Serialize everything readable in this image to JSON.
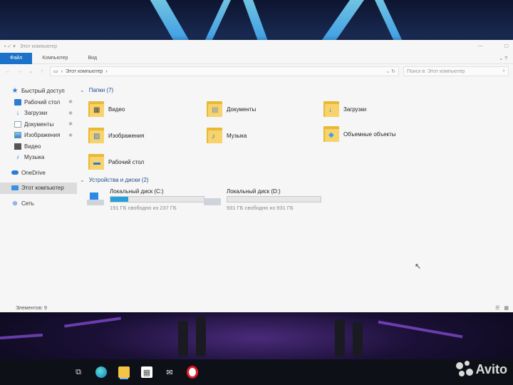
{
  "window": {
    "title_tabs": [
      "Файл",
      "Компьютер",
      "Вид"
    ],
    "address_path": "Этот компьютер",
    "search_placeholder": "Поиск в: Этот компьютер"
  },
  "nav": {
    "items": [
      {
        "label": "Быстрый доступ",
        "icon": "star-icon",
        "pinned": false
      },
      {
        "label": "Рабочий стол",
        "icon": "desktop-icon",
        "pinned": true
      },
      {
        "label": "Загрузки",
        "icon": "download-icon",
        "pinned": true
      },
      {
        "label": "Документы",
        "icon": "document-icon",
        "pinned": true
      },
      {
        "label": "Изображения",
        "icon": "image-icon",
        "pinned": true
      },
      {
        "label": "Видео",
        "icon": "video-icon",
        "pinned": false
      },
      {
        "label": "Музыка",
        "icon": "music-icon",
        "pinned": false
      },
      {
        "label": "OneDrive",
        "icon": "cloud-icon",
        "pinned": false
      },
      {
        "label": "Этот компьютер",
        "icon": "computer-icon",
        "pinned": false
      },
      {
        "label": "Сеть",
        "icon": "network-icon",
        "pinned": false
      }
    ]
  },
  "folders": {
    "header": "Папки (7)",
    "items": [
      {
        "label": "Видео",
        "icon": "video-folder-icon"
      },
      {
        "label": "Документы",
        "icon": "documents-folder-icon"
      },
      {
        "label": "Загрузки",
        "icon": "downloads-folder-icon"
      },
      {
        "label": "Изображения",
        "icon": "pictures-folder-icon"
      },
      {
        "label": "Музыка",
        "icon": "music-folder-icon"
      },
      {
        "label": "Объемные объекты",
        "icon": "3d-objects-folder-icon"
      },
      {
        "label": "Рабочий стол",
        "icon": "desktop-folder-icon"
      }
    ]
  },
  "drives": {
    "header": "Устройства и диски (2)",
    "items": [
      {
        "label": "Локальный диск (C:)",
        "free_text": "191 ГБ свободно из 237 ГБ",
        "used_fraction": 0.19,
        "icon": "windows-drive-icon"
      },
      {
        "label": "Локальный диск (D:)",
        "free_text": "931 ГБ свободно из 931 ГБ",
        "used_fraction": 0.0,
        "icon": "drive-icon"
      }
    ]
  },
  "status": {
    "item_count": "Элементов: 9"
  },
  "watermark": "Avito",
  "colors": {
    "accent": "#1a73c9",
    "drive_bar": "#26a0da",
    "folder": "#f8d36b"
  }
}
